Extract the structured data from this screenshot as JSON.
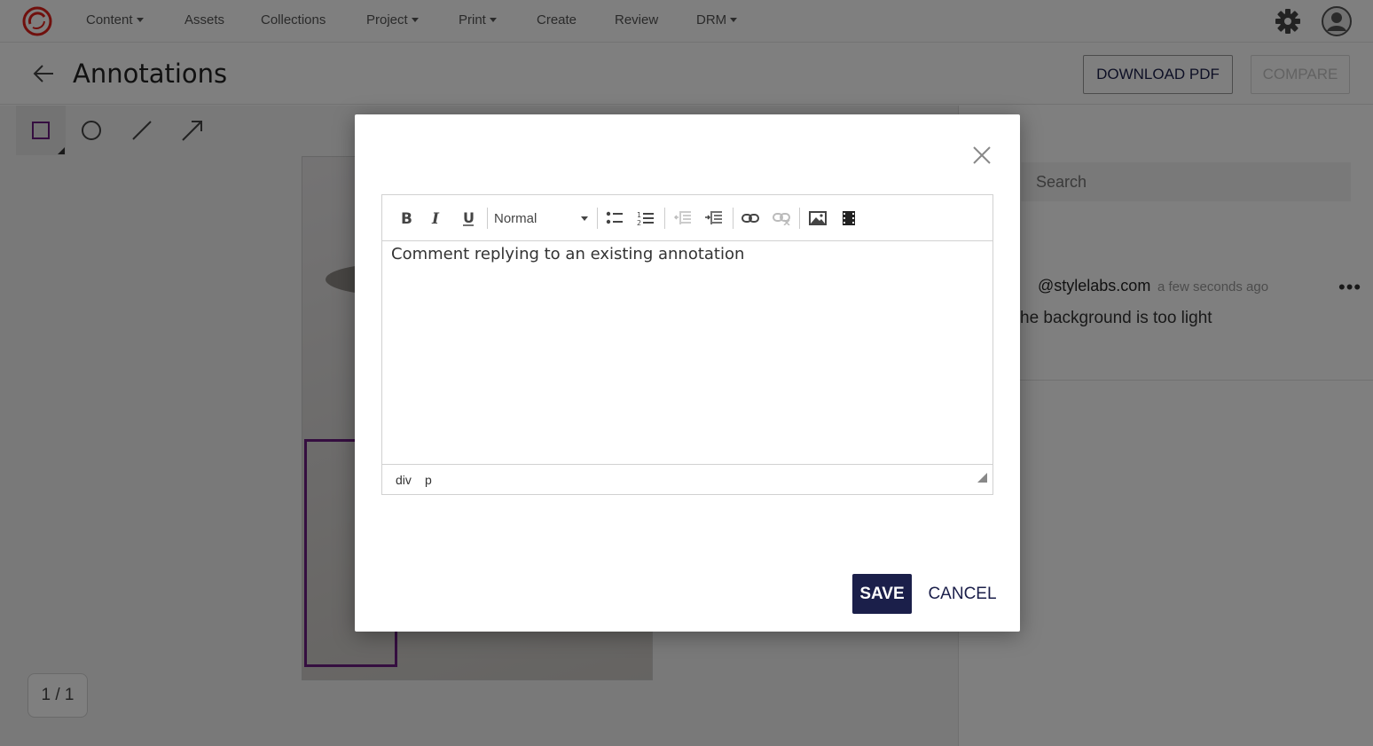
{
  "nav": {
    "items": [
      {
        "label": "Content",
        "has_caret": true
      },
      {
        "label": "Assets",
        "has_caret": false
      },
      {
        "label": "Collections",
        "has_caret": false
      },
      {
        "label": "Project",
        "has_caret": true
      },
      {
        "label": "Print",
        "has_caret": true
      },
      {
        "label": "Create",
        "has_caret": false
      },
      {
        "label": "Review",
        "has_caret": false
      },
      {
        "label": "DRM",
        "has_caret": true
      }
    ],
    "logo_icon": "sitecore-logo",
    "settings_icon": "gear-icon",
    "user_icon": "avatar-icon"
  },
  "header": {
    "title": "Annotations",
    "download_label": "DOWNLOAD PDF",
    "compare_label": "COMPARE"
  },
  "tools": {
    "items": [
      "rectangle-tool-icon",
      "circle-tool-icon",
      "line-tool-icon",
      "arrow-tool-icon"
    ],
    "active": "rectangle-tool-icon"
  },
  "viewer": {
    "pager": "1 / 1",
    "annotation_color": "#6b1d80"
  },
  "side": {
    "search_placeholder": "Search",
    "comment": {
      "user": "@stylelabs.com",
      "time": "a few seconds ago",
      "text": "he background is too light",
      "menu": "•••"
    }
  },
  "modal": {
    "format_value": "Normal",
    "content": "Comment replying to an existing annotation",
    "path": [
      "div",
      "p"
    ],
    "save_label": "SAVE",
    "cancel_label": "CANCEL",
    "accent": "#1b1f4a"
  }
}
